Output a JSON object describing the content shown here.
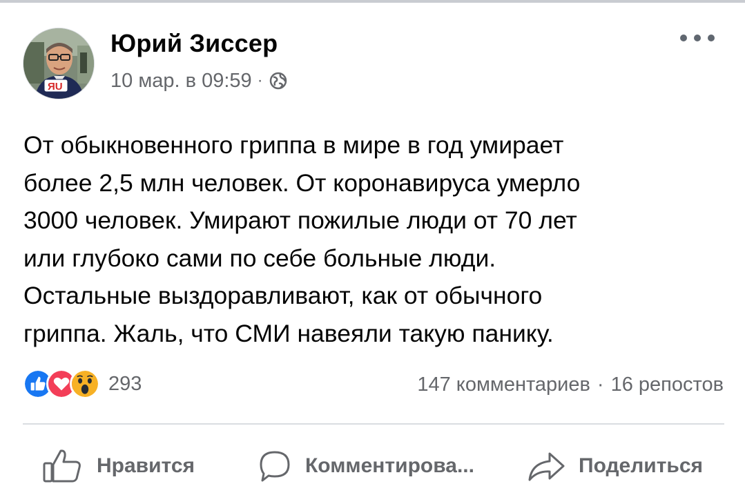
{
  "post": {
    "author": "Юрий Зиссер",
    "date": "10 мар. в 09:59",
    "separator": "·",
    "avatar_badge": "ЯU",
    "text": "От обыкновенного гриппа в мире в год умирает\nболее 2,5 млн человек. От коронавируса умерло\n3000 человек. Умирают пожилые люди от 70 лет\nили глубоко сами по себе больные люди.\nОстальные выздоравливают, как от обычного\nгриппа. Жаль,  что СМИ навеяли такую панику."
  },
  "reactions": {
    "icons": [
      "like-reaction-icon",
      "love-reaction-icon",
      "wow-reaction-icon"
    ],
    "count": "293"
  },
  "stats": {
    "comments": "147 комментариев",
    "separator": "·",
    "shares": "16 репостов"
  },
  "actions": {
    "like": "Нравится",
    "comment": "Комментирова...",
    "share": "Поделиться"
  },
  "colors": {
    "text_primary": "#050505",
    "text_secondary": "#65676b",
    "like_blue": "#1877f2",
    "love_red": "#f33e58",
    "wow_yellow": "#f7b125",
    "divider": "#dadde1"
  }
}
